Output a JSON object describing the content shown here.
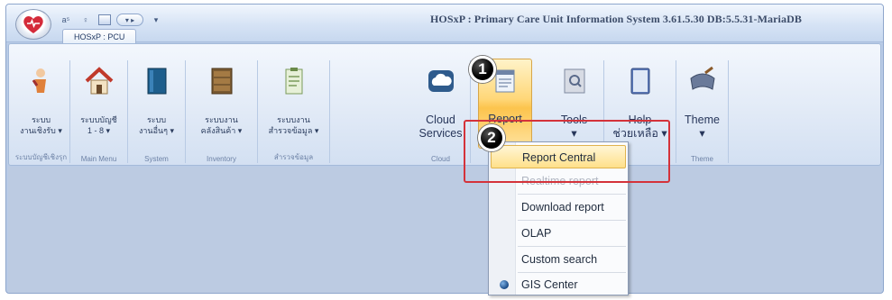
{
  "app": {
    "title": "HOSxP : Primary Care Unit Information System 3.61.5.30 DB:5.5.31-MariaDB",
    "tab": "HOSxP : PCU"
  },
  "ribbon": {
    "groups": [
      {
        "label": "ระบบ\nงานเชิงรับ ▾",
        "caption": "ระบบบัญชีเชิงรุก",
        "icon": "person-icon"
      },
      {
        "label": "ระบบบัญชี\n1 - 8 ▾",
        "caption": "Main Menu",
        "icon": "house-icon"
      },
      {
        "label": "ระบบ\nงานอื่นๆ ▾",
        "caption": "System",
        "icon": "book-icon"
      },
      {
        "label": "ระบบงาน\nคลังสินค้า ▾",
        "caption": "Inventory",
        "icon": "cabinet-icon"
      },
      {
        "label": "ระบบงาน\nสำรวจข้อมูล ▾",
        "caption": "สำรวจข้อมูล",
        "icon": "clipboard-icon"
      },
      {
        "label": "Cloud\nServices",
        "caption": "Cloud",
        "icon": "cloud-icon"
      },
      {
        "label": "Report",
        "caption": "",
        "icon": "report-icon"
      },
      {
        "label": "Tools\n▾",
        "caption": "",
        "icon": "tools-icon"
      },
      {
        "label": "Help\nช่วยเหลือ ▾",
        "caption": "",
        "icon": "help-icon"
      },
      {
        "label": "Theme\n▾",
        "caption": "Theme",
        "icon": "theme-icon"
      }
    ]
  },
  "menu": {
    "items": [
      "Report Central",
      "Realtime report",
      "Download report",
      "OLAP",
      "Custom search",
      "GIS Center"
    ]
  },
  "callouts": [
    "1",
    "2"
  ],
  "colors": {
    "highlight": "#ffe08a",
    "red_frame": "#d4323a",
    "ribbon": "#dce6f4"
  }
}
